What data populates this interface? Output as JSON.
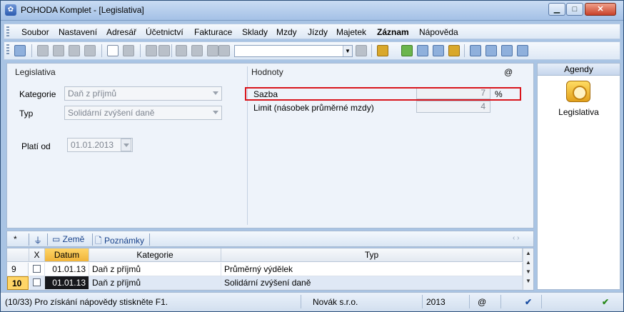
{
  "window": {
    "title": "POHODA Komplet - [Legislativa]",
    "icon": "pohoda-app-icon"
  },
  "menu": [
    "Soubor",
    "Nastavení",
    "Adresář",
    "Účetnictví",
    "Fakturace",
    "Sklady",
    "Mzdy",
    "Jízdy",
    "Majetek",
    "Záznam",
    "Nápověda"
  ],
  "form": {
    "left_title": "Legislativa",
    "kategorie_label": "Kategorie",
    "kategorie_value": "Daň z příjmů",
    "typ_label": "Typ",
    "typ_value": "Solidární zvýšení daně",
    "plati_od_label": "Platí od",
    "plati_od_value": "01.01.2013",
    "right_title": "Hodnoty",
    "at_symbol": "@",
    "sazba_label": "Sazba",
    "sazba_value": "7",
    "sazba_unit": "%",
    "limit_label": "Limit (násobek průměrné mzdy)",
    "limit_value": "4"
  },
  "agenda": {
    "header": "Agendy",
    "item_label": "Legislativa"
  },
  "tabs": {
    "star": "*",
    "zeme": "Země",
    "poznamky": "Poznámky"
  },
  "table": {
    "headers": {
      "x": "X",
      "datum": "Datum",
      "kategorie": "Kategorie",
      "typ": "Typ"
    },
    "rows": [
      {
        "num": "9",
        "datum": "01.01.13",
        "kategorie": "Daň z příjmů",
        "typ": "Průměrný výdělek"
      },
      {
        "num": "10",
        "datum": "01.01.13",
        "kategorie": "Daň z příjmů",
        "typ": "Solidární zvýšení daně"
      }
    ]
  },
  "status": {
    "help": "(10/33) Pro získání nápovědy stiskněte F1.",
    "company": "Novák  s.r.o.",
    "year": "2013",
    "at": "@"
  },
  "colors": {
    "highlight_border": "#d9141b",
    "selected_row": "#ffd567",
    "accent": "#17418a"
  }
}
